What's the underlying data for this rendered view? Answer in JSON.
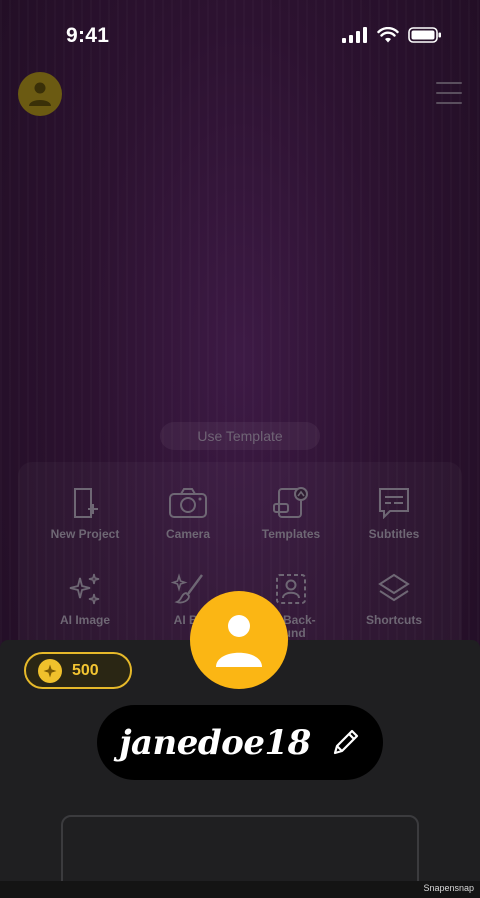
{
  "status_bar": {
    "time": "9:41"
  },
  "background": {
    "use_template_label": "Use Template",
    "tools": [
      {
        "label": "New Project",
        "icon": "new-project-icon"
      },
      {
        "label": "Camera",
        "icon": "camera-icon"
      },
      {
        "label": "Templates",
        "icon": "templates-icon"
      },
      {
        "label": "Subtitles",
        "icon": "subtitles-icon"
      },
      {
        "label": "AI Image",
        "icon": "sparkles-icon"
      },
      {
        "label": "AI Br",
        "icon": "ai-brush-icon"
      },
      {
        "label": "ve Back-\nound",
        "icon": "remove-background-icon"
      },
      {
        "label": "Shortcuts",
        "icon": "layers-icon"
      }
    ]
  },
  "profile": {
    "coins": "500",
    "username": "janedoe18"
  },
  "footer": {
    "watermark": "Snapensnap"
  },
  "colors": {
    "accent": "#fbb614",
    "coin_border": "#e6b92a",
    "sheet_bg": "#1f1f21",
    "background_purple": "#2c1230"
  }
}
